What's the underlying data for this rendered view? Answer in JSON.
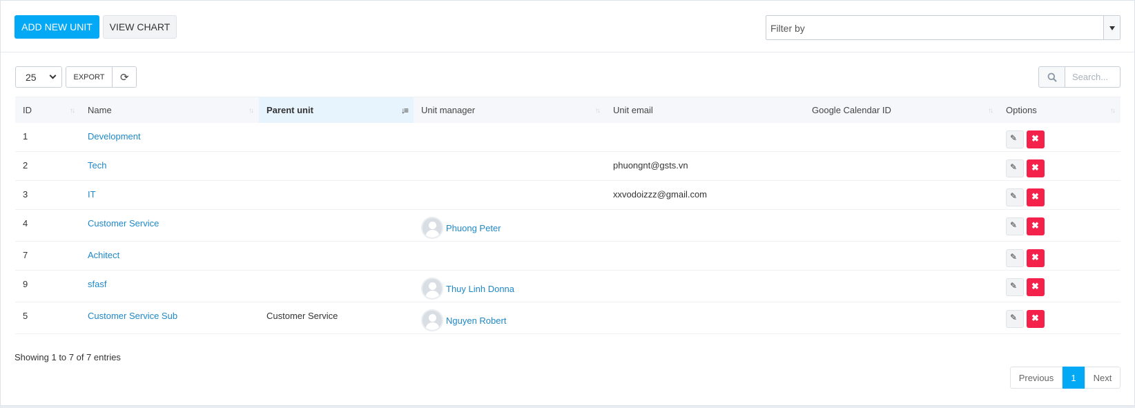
{
  "toolbar": {
    "add_label": "ADD NEW UNIT",
    "chart_label": "VIEW CHART",
    "filter_placeholder": "Filter by"
  },
  "controls": {
    "page_length": "25",
    "export_label": "EXPORT",
    "search_placeholder": "Search..."
  },
  "table": {
    "columns": [
      "ID",
      "Name",
      "Parent unit",
      "Unit manager",
      "Unit email",
      "Google Calendar ID",
      "Options"
    ],
    "sorted_column": "Parent unit",
    "rows": [
      {
        "id": "1",
        "name": "Development",
        "parent": "",
        "manager": "",
        "email": "",
        "calendar": ""
      },
      {
        "id": "2",
        "name": "Tech",
        "parent": "",
        "manager": "",
        "email": "phuongnt@gsts.vn",
        "calendar": ""
      },
      {
        "id": "3",
        "name": "IT",
        "parent": "",
        "manager": "",
        "email": "xxvodoizzz@gmail.com",
        "calendar": ""
      },
      {
        "id": "4",
        "name": "Customer Service",
        "parent": "",
        "manager": "Phuong Peter",
        "email": "",
        "calendar": ""
      },
      {
        "id": "7",
        "name": "Achitect",
        "parent": "",
        "manager": "",
        "email": "",
        "calendar": ""
      },
      {
        "id": "9",
        "name": "sfasf",
        "parent": "",
        "manager": "Thuy Linh Donna",
        "email": "",
        "calendar": ""
      },
      {
        "id": "5",
        "name": "Customer Service Sub",
        "parent": "Customer Service",
        "manager": "Nguyen Robert",
        "email": "",
        "calendar": ""
      }
    ]
  },
  "footer": {
    "info": "Showing 1 to 7 of 7 entries",
    "previous": "Previous",
    "current_page": "1",
    "next": "Next"
  },
  "icons": {
    "edit": "edit-icon",
    "delete": "delete-icon",
    "search": "search-icon",
    "refresh": "refresh-icon"
  },
  "colors": {
    "primary": "#03a9f4",
    "danger": "#f4224a",
    "link": "#1e88c7"
  }
}
